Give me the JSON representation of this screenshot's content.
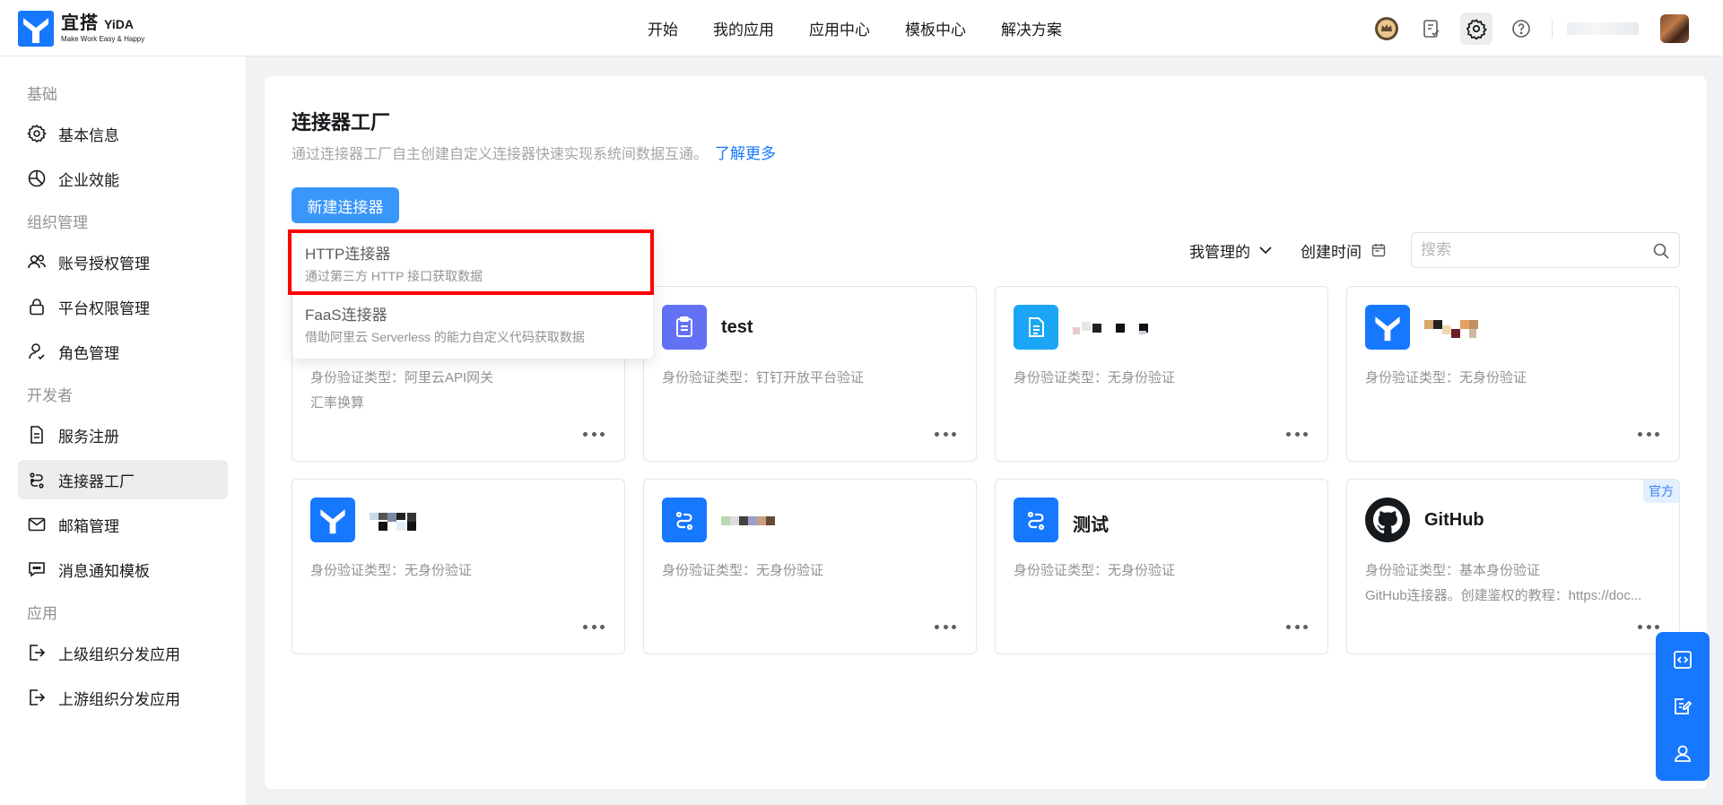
{
  "brand": {
    "name_cn": "宜搭",
    "name_en": "YiDA",
    "slogan": "Make Work Easy & Happy"
  },
  "topnav": [
    "开始",
    "我的应用",
    "应用中心",
    "模板中心",
    "解决方案"
  ],
  "sidebar": {
    "sections": [
      {
        "title": "基础",
        "items": [
          "基本信息",
          "企业效能"
        ]
      },
      {
        "title": "组织管理",
        "items": [
          "账号授权管理",
          "平台权限管理",
          "角色管理"
        ]
      },
      {
        "title": "开发者",
        "items": [
          "服务注册",
          "连接器工厂",
          "邮箱管理",
          "消息通知模板"
        ]
      },
      {
        "title": "应用",
        "items": [
          "上级组织分发应用",
          "上游组织分发应用"
        ]
      }
    ],
    "active": "连接器工厂"
  },
  "page": {
    "title": "连接器工厂",
    "description": "通过连接器工厂自主创建自定义连接器快速实现系统间数据互通。",
    "learn_more": "了解更多",
    "new_button": "新建连接器",
    "filter_label": "我管理的",
    "sort_label": "创建时间",
    "search_placeholder": "搜索"
  },
  "dropdown": [
    {
      "title": "HTTP连接器",
      "subtitle": "通过第三方 HTTP 接口获取数据"
    },
    {
      "title": "FaaS连接器",
      "subtitle": "借助阿里云 Serverless 的能力自定义代码获取数据"
    }
  ],
  "cards": [
    {
      "name": "",
      "auth": "身份验证类型：阿里云API网关",
      "desc": "汇率换算",
      "icon": "connector-icon",
      "color": "#1677ff"
    },
    {
      "name": "test",
      "auth": "身份验证类型：钉钉开放平台验证",
      "desc": "",
      "icon": "clipboard-icon",
      "color": "#6372f5"
    },
    {
      "name": "",
      "auth": "身份验证类型：无身份验证",
      "desc": "",
      "icon": "document-icon",
      "color": "#1ba5f5"
    },
    {
      "name": "",
      "auth": "身份验证类型：无身份验证",
      "desc": "",
      "icon": "yida-logo-icon",
      "color": "#1677ff"
    },
    {
      "name": "",
      "auth": "身份验证类型：无身份验证",
      "desc": "",
      "icon": "yida-logo-icon",
      "color": "#1677ff"
    },
    {
      "name": "",
      "auth": "身份验证类型：无身份验证",
      "desc": "",
      "icon": "connector-icon",
      "color": "#1677ff"
    },
    {
      "name": "测试",
      "auth": "身份验证类型：无身份验证",
      "desc": "",
      "icon": "connector-icon",
      "color": "#1677ff"
    },
    {
      "name": "GitHub",
      "auth": "身份验证类型：基本身份验证",
      "desc": "GitHub连接器。创建鉴权的教程：https://doc...",
      "icon": "github-icon",
      "color": "#171a1d",
      "badge": "官方"
    }
  ]
}
